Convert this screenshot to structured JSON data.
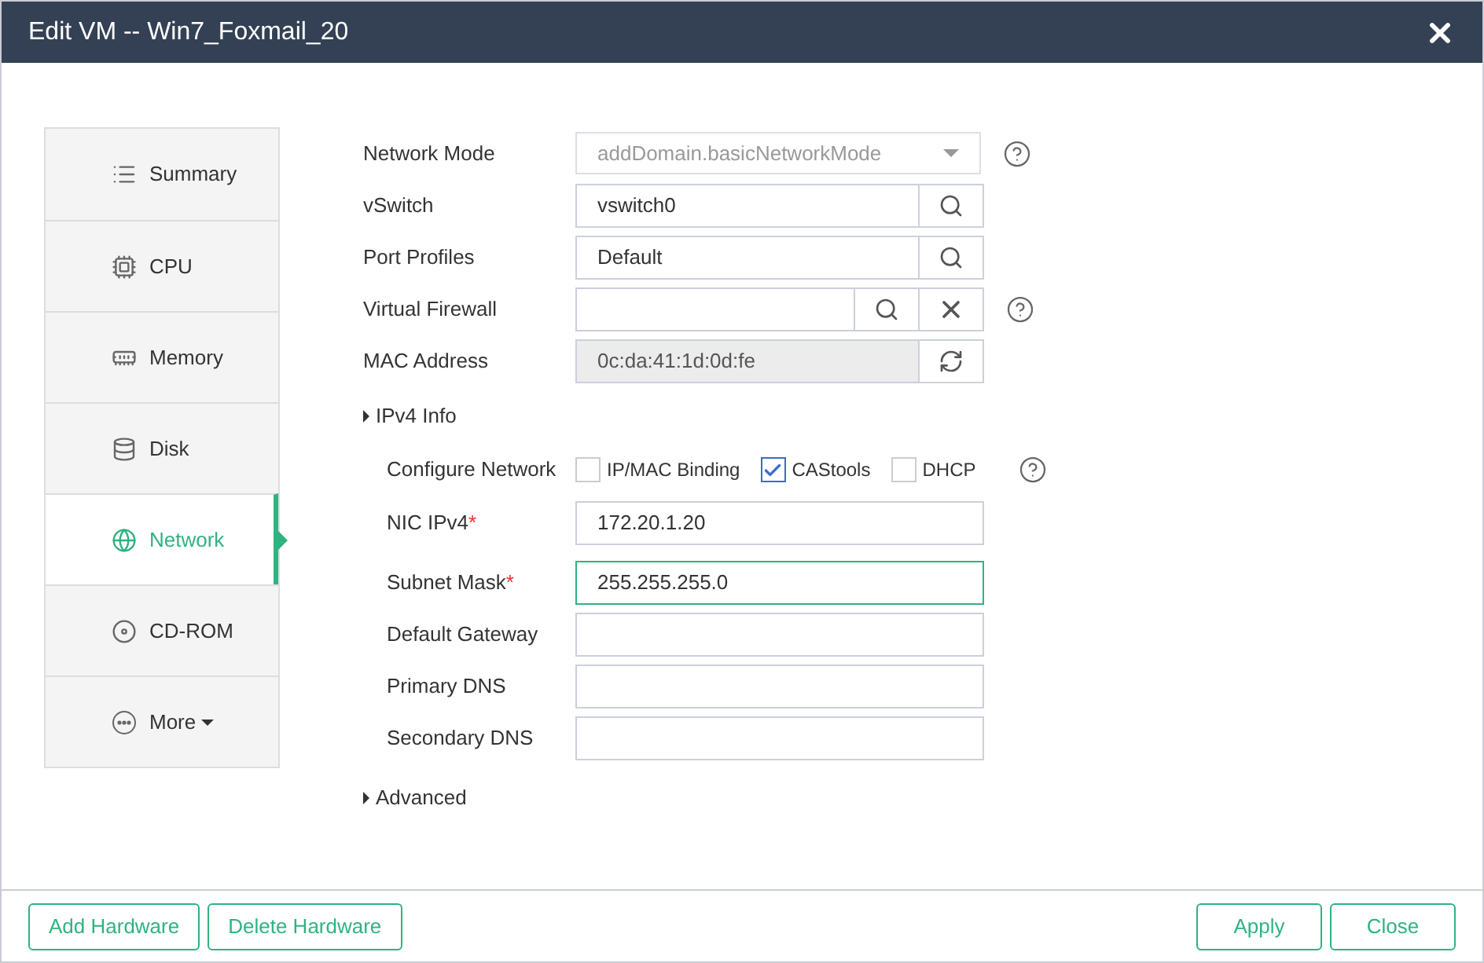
{
  "window": {
    "title": "Edit VM -- Win7_Foxmail_20"
  },
  "sidebar": {
    "items": [
      {
        "label": "Summary",
        "selected": false
      },
      {
        "label": "CPU",
        "selected": false
      },
      {
        "label": "Memory",
        "selected": false
      },
      {
        "label": "Disk",
        "selected": false
      },
      {
        "label": "Network",
        "selected": true
      },
      {
        "label": "CD-ROM",
        "selected": false
      },
      {
        "label": "More",
        "selected": false,
        "dropdown": true
      }
    ]
  },
  "network": {
    "fields": [
      {
        "label": "Network Mode",
        "kind": "select",
        "value": "addDomain.basicNetworkMode",
        "disabled": true,
        "help": true
      },
      {
        "label": "vSwitch",
        "kind": "lookup",
        "value": "vswitch0",
        "actions": [
          {
            "kind": "search"
          }
        ]
      },
      {
        "label": "Port Profiles",
        "kind": "lookup",
        "value": "Default",
        "actions": [
          {
            "kind": "search"
          }
        ]
      },
      {
        "label": "Virtual Firewall",
        "kind": "lookup",
        "actions": [
          {
            "kind": "search"
          },
          {
            "kind": "clear"
          }
        ],
        "help": true
      },
      {
        "label": "MAC Address",
        "kind": "lookup",
        "value": "0c:da:41:1d:0d:fe",
        "disabled": true,
        "actions": [
          {
            "kind": "refresh"
          }
        ]
      }
    ],
    "ipv4": {
      "title": "IPv4 Info",
      "configure": {
        "label": "Configure Network",
        "options": [
          {
            "label": "IP/MAC Binding",
            "checked": false
          },
          {
            "label": "CAStools",
            "checked": true
          },
          {
            "label": "DHCP",
            "checked": false
          }
        ],
        "help": true
      },
      "fields": [
        {
          "label": "NIC IPv4",
          "value": "172.20.1.20",
          "required_mark": "*",
          "focused": false
        },
        {
          "label": "Subnet Mask",
          "value": "255.255.255.0",
          "required_mark": "*",
          "focused": true
        },
        {
          "label": "Default Gateway",
          "focused": false
        },
        {
          "label": "Primary DNS",
          "focused": false
        },
        {
          "label": "Secondary DNS",
          "focused": false
        }
      ]
    },
    "advanced": {
      "title": "Advanced"
    }
  },
  "footer": {
    "left_buttons": [
      "Add Hardware",
      "Delete Hardware"
    ],
    "right_buttons": [
      "Apply",
      "Close"
    ]
  }
}
